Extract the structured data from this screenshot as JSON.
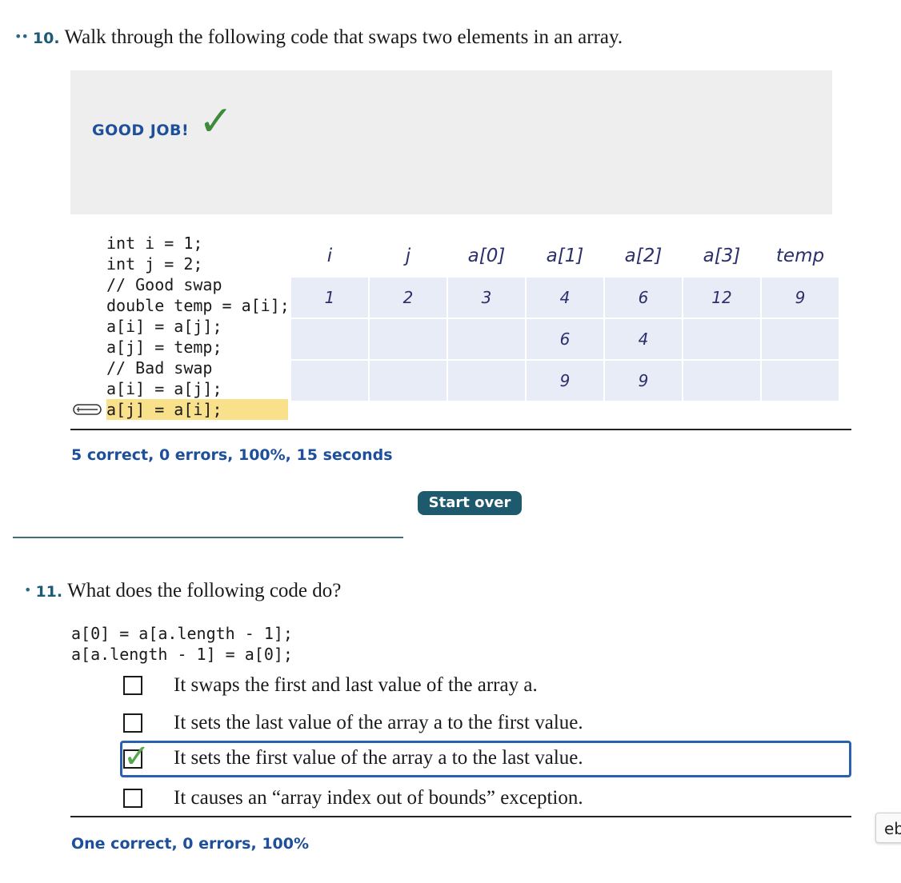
{
  "q10": {
    "dots": "••",
    "number": "10.",
    "prompt": "Walk through the following code that swaps two elements in an array.",
    "feedback": "GOOD JOB!",
    "code_lines": [
      "int i = 1;",
      "int j = 2;",
      "// Good swap",
      "double temp = a[i];",
      "a[i] = a[j];",
      "a[j] = temp;",
      "// Bad swap",
      "a[i] = a[j];",
      "a[j] = a[i];"
    ],
    "table": {
      "headers": [
        "i",
        "j",
        "a[0]",
        "a[1]",
        "a[2]",
        "a[3]",
        "temp"
      ],
      "rows": [
        [
          "1",
          "2",
          "3",
          "4",
          "6",
          "12",
          "9"
        ],
        [
          "",
          "",
          "",
          "6",
          "4",
          "",
          ""
        ],
        [
          "",
          "",
          "",
          "9",
          "9",
          "",
          ""
        ]
      ]
    },
    "stats": "5 correct, 0 errors, 100%, 15 seconds",
    "start_over": "Start over"
  },
  "q11": {
    "dots": "•",
    "number": "11.",
    "prompt": "What does the following code do?",
    "code_lines": [
      "a[0] = a[a.length - 1];",
      "a[a.length - 1] = a[0];"
    ],
    "options": [
      {
        "label": "It swaps the first and last value of the array a.",
        "checked": false
      },
      {
        "label": "It sets the last value of the array a to the first value.",
        "checked": false
      },
      {
        "label": "It sets the first value of the array a to the last value.",
        "checked": true
      },
      {
        "label": "It causes an “array index out of bounds” exception.",
        "checked": false
      }
    ],
    "stats": "One correct, 0 errors, 100%"
  },
  "side_tab": "eb",
  "colors": {
    "accent": "#1d4f9a",
    "button": "#1e5a6e",
    "highlight": "#f9e08a",
    "cell": "#e8ecf6",
    "check": "#3f8a3a",
    "selected_border": "#2c5fb0"
  }
}
